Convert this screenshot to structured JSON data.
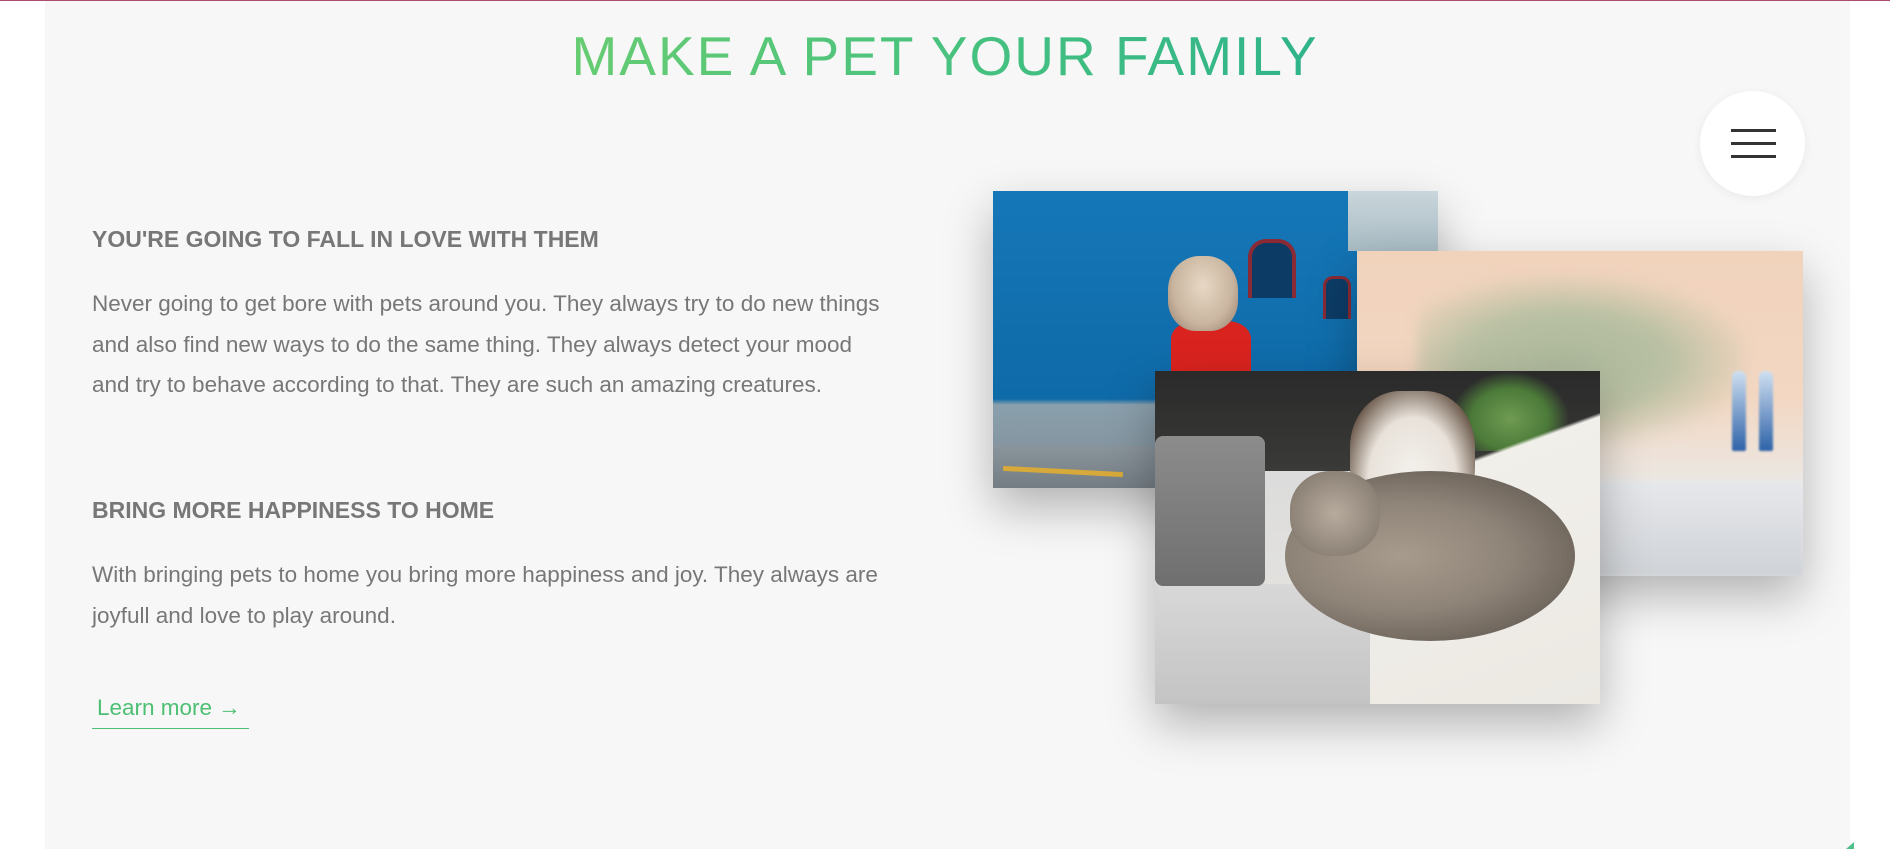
{
  "header": {
    "title": "MAKE A PET YOUR FAMILY"
  },
  "menu": {
    "icon": "hamburger-icon"
  },
  "sections": [
    {
      "heading": "YOU'RE GOING TO FALL IN LOVE WITH THEM",
      "body": "Never going to get bore with pets around you. They always try to do new things and also find new ways to do the same thing. They always detect your mood and try to behave according to that. They are such an amazing creatures."
    },
    {
      "heading": "BRING MORE HAPPINESS TO HOME",
      "body": "With bringing pets to home you bring more happiness and joy. They always are joyfull and love to play around."
    }
  ],
  "cta": {
    "label": "Learn more →"
  },
  "colors": {
    "accent": "#4dbf73",
    "title_gradient_start": "#67cc72",
    "title_gradient_end": "#2fb38a",
    "text": "#777777",
    "panel": "#f7f7f7"
  },
  "images": [
    {
      "name": "dog-in-red-jacket-photo"
    },
    {
      "name": "blurred-bedroom-photo"
    },
    {
      "name": "husky-and-cat-photo"
    }
  ]
}
